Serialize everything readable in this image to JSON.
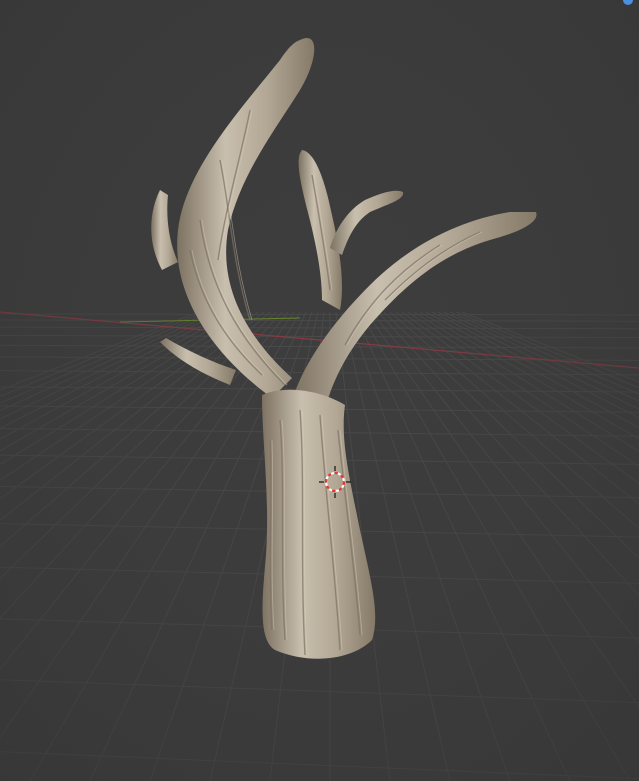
{
  "viewport": {
    "background_color": "#3d3d3d",
    "grid_color": "#4a4a4a",
    "x_axis_color": "#8a3b44",
    "y_axis_color": "#6b8a2e",
    "show_grid": true,
    "show_axes": true
  },
  "model": {
    "name": "tree",
    "material_color": "#b3a795",
    "shadow_color": "#7d7262",
    "highlight_color": "#d9cfbf"
  },
  "cursor_3d": {
    "icon": "3d-cursor-icon",
    "ring_color_a": "#e8352e",
    "ring_color_b": "#ffffff"
  },
  "indicator": {
    "icon": "status-dot-icon",
    "color": "#4a8fe0"
  }
}
